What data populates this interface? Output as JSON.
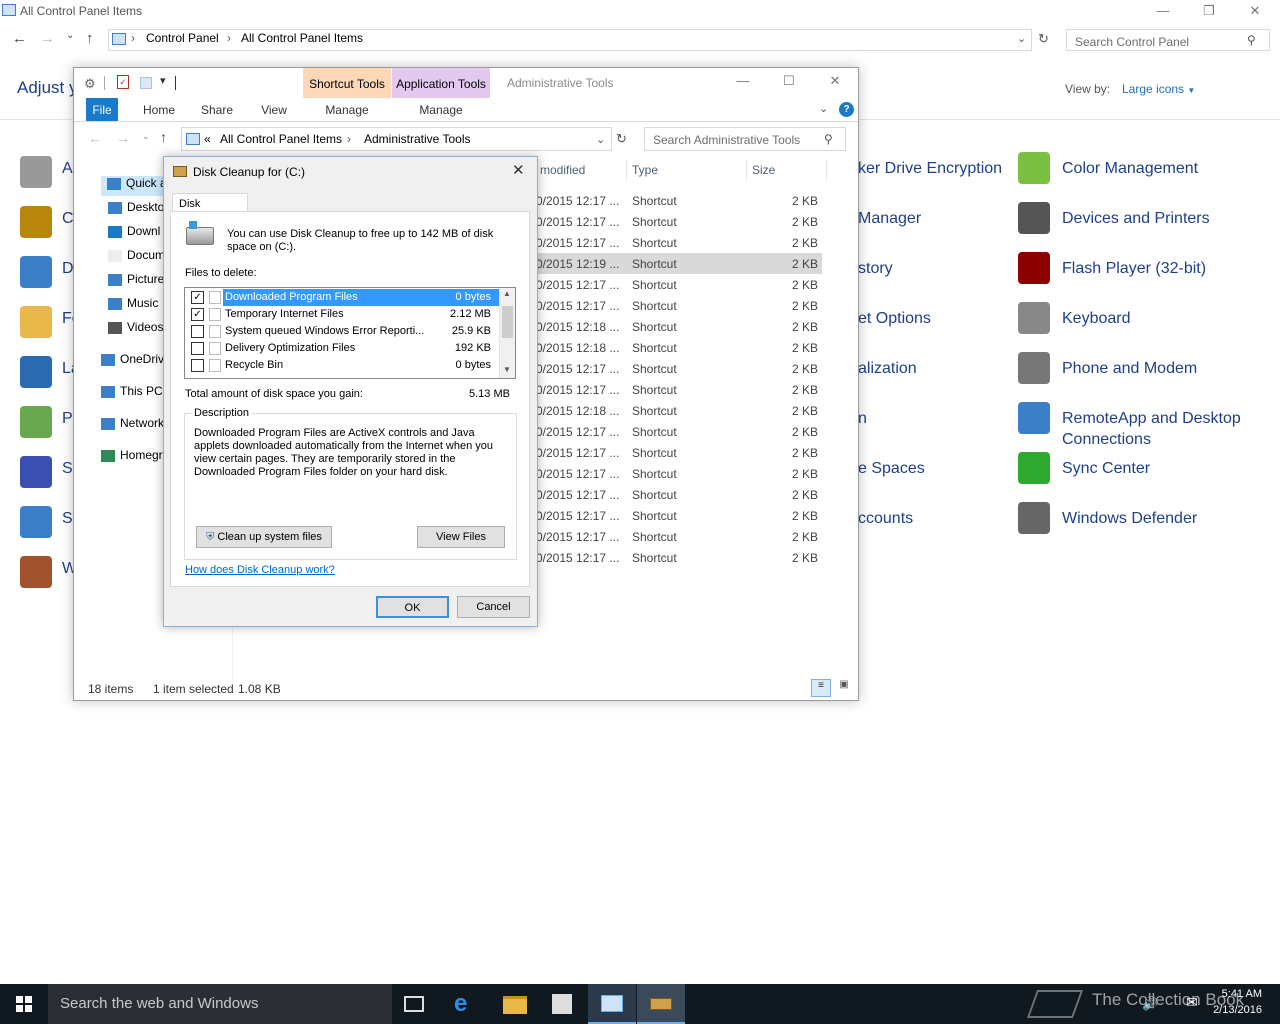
{
  "control_panel": {
    "title": "All Control Panel Items",
    "breadcrumb": [
      "Control Panel",
      "All Control Panel Items"
    ],
    "search_placeholder": "Search Control Panel",
    "heading": "Adjust y",
    "view_by_label": "View by:",
    "view_by_value": "Large icons",
    "left_items": [
      "A",
      "C",
      "D",
      "Fo",
      "La",
      "Po",
      "Se",
      "Sy",
      "W"
    ],
    "mid_items": [
      "ker Drive Encryption",
      "Manager",
      "story",
      "et Options",
      "alization",
      "n",
      "e Spaces",
      "ccounts"
    ],
    "right_items": [
      {
        "label": "Color Management",
        "icon": "color-management-icon",
        "color": "#7bc043"
      },
      {
        "label": "Devices and Printers",
        "icon": "printer-icon",
        "color": "#555555"
      },
      {
        "label": "Flash Player (32-bit)",
        "icon": "flash-icon",
        "color": "#8b0000"
      },
      {
        "label": "Keyboard",
        "icon": "keyboard-icon",
        "color": "#888888"
      },
      {
        "label": "Phone and Modem",
        "icon": "phone-icon",
        "color": "#777777"
      },
      {
        "label": "RemoteApp and Desktop",
        "label2": "Connections",
        "icon": "remoteapp-icon",
        "color": "#3a7fc8"
      },
      {
        "label": "Sync Center",
        "icon": "sync-icon",
        "color": "#2ea82e"
      },
      {
        "label": "Windows Defender",
        "icon": "defender-icon",
        "color": "#666666"
      }
    ]
  },
  "explorer": {
    "title": "Administrative Tools",
    "shortcut_tools": "Shortcut Tools",
    "application_tools": "Application Tools",
    "ribbon_tabs": [
      "File",
      "Home",
      "Share",
      "View",
      "Manage",
      "Manage"
    ],
    "breadcrumb": [
      "«",
      "All Control Panel Items",
      "Administrative Tools"
    ],
    "search_placeholder": "Search Administrative Tools",
    "nav_items": [
      "Quick ac",
      "Deskto",
      "Downl",
      "Docum",
      "Picture",
      "Music",
      "Videos",
      "OneDriv",
      "This PC",
      "Network",
      "Homegr"
    ],
    "columns": [
      "modified",
      "Type",
      "Size"
    ],
    "rows": [
      {
        "date": "0/2015 12:17 ...",
        "type": "Shortcut",
        "size": "2 KB"
      },
      {
        "date": "0/2015 12:17 ...",
        "type": "Shortcut",
        "size": "2 KB"
      },
      {
        "date": "0/2015 12:17 ...",
        "type": "Shortcut",
        "size": "2 KB"
      },
      {
        "date": "0/2015 12:19 ...",
        "type": "Shortcut",
        "size": "2 KB"
      },
      {
        "date": "0/2015 12:17 ...",
        "type": "Shortcut",
        "size": "2 KB"
      },
      {
        "date": "0/2015 12:17 ...",
        "type": "Shortcut",
        "size": "2 KB"
      },
      {
        "date": "0/2015 12:18 ...",
        "type": "Shortcut",
        "size": "2 KB"
      },
      {
        "date": "0/2015 12:18 ...",
        "type": "Shortcut",
        "size": "2 KB"
      },
      {
        "date": "0/2015 12:17 ...",
        "type": "Shortcut",
        "size": "2 KB"
      },
      {
        "date": "0/2015 12:17 ...",
        "type": "Shortcut",
        "size": "2 KB"
      },
      {
        "date": "0/2015 12:18 ...",
        "type": "Shortcut",
        "size": "2 KB"
      },
      {
        "date": "0/2015 12:17 ...",
        "type": "Shortcut",
        "size": "2 KB"
      },
      {
        "date": "0/2015 12:17 ...",
        "type": "Shortcut",
        "size": "2 KB"
      },
      {
        "date": "0/2015 12:17 ...",
        "type": "Shortcut",
        "size": "2 KB"
      },
      {
        "date": "0/2015 12:17 ...",
        "type": "Shortcut",
        "size": "2 KB"
      },
      {
        "date": "0/2015 12:17 ...",
        "type": "Shortcut",
        "size": "2 KB"
      },
      {
        "date": "0/2015 12:17 ...",
        "type": "Shortcut",
        "size": "2 KB"
      },
      {
        "date": "0/2015 12:17 ...",
        "type": "Shortcut",
        "size": "2 KB"
      }
    ],
    "selected_row": 3,
    "status_items": "18 items",
    "status_selected": "1 item selected",
    "status_size": "1.08 KB"
  },
  "dialog": {
    "title": "Disk Cleanup for  (C:)",
    "tab": "Disk Cleanup",
    "intro_line1": "You can use Disk Cleanup to free up to 142 MB of disk",
    "intro_line2": "space on  (C:).",
    "files_label": "Files to delete:",
    "files": [
      {
        "name": "Downloaded Program Files",
        "size": "0 bytes",
        "checked": true
      },
      {
        "name": "Temporary Internet Files",
        "size": "2.12 MB",
        "checked": true
      },
      {
        "name": "System queued Windows Error Reporti...",
        "size": "25.9 KB",
        "checked": false
      },
      {
        "name": "Delivery Optimization Files",
        "size": "192 KB",
        "checked": false
      },
      {
        "name": "Recycle Bin",
        "size": "0 bytes",
        "checked": false
      }
    ],
    "total_label": "Total amount of disk space you gain:",
    "total_value": "5.13 MB",
    "description_label": "Description",
    "description": "Downloaded Program Files are ActiveX controls and Java applets downloaded automatically from the Internet when you view certain pages. They are temporarily stored in the Downloaded Program Files folder on your hard disk.",
    "cleanup_button": "Clean up system files",
    "view_files_button": "View Files",
    "help_link": "How does Disk Cleanup work?",
    "ok": "OK",
    "cancel": "Cancel"
  },
  "taskbar": {
    "search": "Search the web and Windows",
    "time": "5:41 AM",
    "date": "2/13/2016",
    "watermark": "The Collection Book"
  }
}
